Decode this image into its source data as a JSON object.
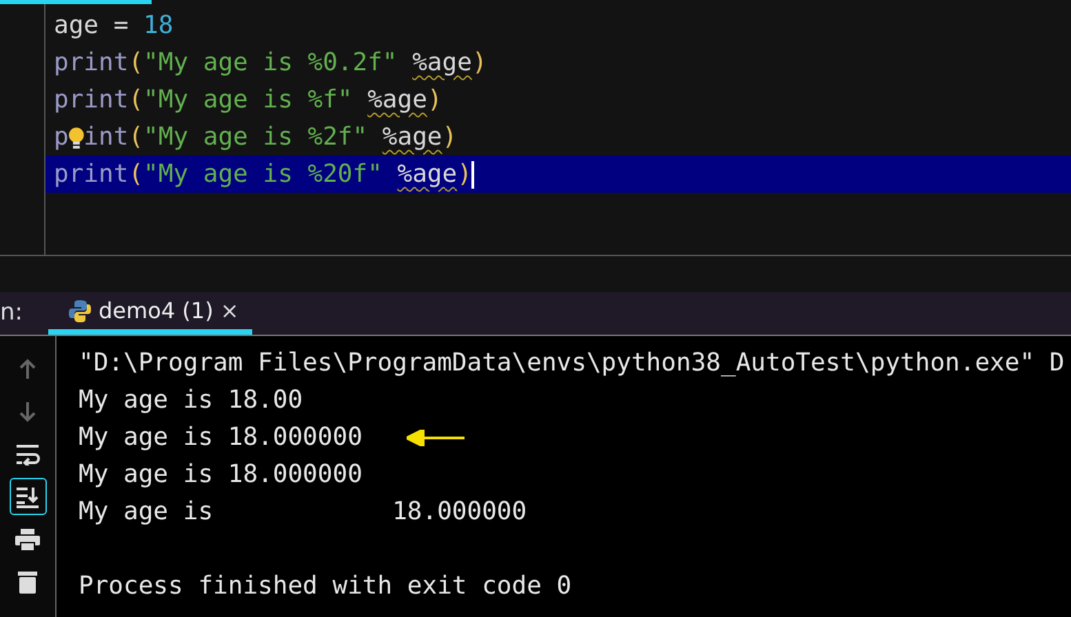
{
  "editor": {
    "lines": [
      {
        "selected": false,
        "tokens": [
          {
            "text": "age",
            "kind": "plain"
          },
          {
            "text": " = ",
            "kind": "plain"
          },
          {
            "text": "18",
            "kind": "number"
          }
        ]
      },
      {
        "selected": false,
        "tokens": [
          {
            "text": "print",
            "kind": "builtin"
          },
          {
            "text": "(",
            "kind": "paren"
          },
          {
            "text": "\"My age is %0.2f\"",
            "kind": "string"
          },
          {
            "kind": "space"
          },
          {
            "text": "%age",
            "kind": "warned"
          },
          {
            "text": ")",
            "kind": "paren"
          }
        ]
      },
      {
        "selected": false,
        "tokens": [
          {
            "text": "print",
            "kind": "builtin"
          },
          {
            "text": "(",
            "kind": "paren"
          },
          {
            "text": "\"My age is %f\"",
            "kind": "string"
          },
          {
            "kind": "space"
          },
          {
            "text": "%age",
            "kind": "warned"
          },
          {
            "text": ")",
            "kind": "paren"
          }
        ]
      },
      {
        "selected": false,
        "tokens": [
          {
            "text": "p",
            "kind": "builtin"
          },
          {
            "kind": "bulb"
          },
          {
            "text": "int",
            "kind": "builtin"
          },
          {
            "text": "(",
            "kind": "paren"
          },
          {
            "text": "\"My age is %2f\"",
            "kind": "string"
          },
          {
            "kind": "space"
          },
          {
            "text": "%age",
            "kind": "warned"
          },
          {
            "text": ")",
            "kind": "paren"
          }
        ]
      },
      {
        "selected": true,
        "tokens": [
          {
            "text": "print",
            "kind": "builtin"
          },
          {
            "text": "(",
            "kind": "paren"
          },
          {
            "text": "\"My age is %20f\"",
            "kind": "string"
          },
          {
            "kind": "space"
          },
          {
            "text": "%age",
            "kind": "warned"
          },
          {
            "text": ")",
            "kind": "paren"
          }
        ]
      }
    ]
  },
  "run_panel": {
    "label": "n:",
    "tabs": [
      {
        "label": "demo4 (1)",
        "close": "×",
        "selected": true
      }
    ],
    "toolbar": [
      {
        "kind": "up",
        "disabled": true,
        "selected": false
      },
      {
        "kind": "down",
        "disabled": true,
        "selected": false
      },
      {
        "kind": "wrap",
        "disabled": false,
        "selected": false
      },
      {
        "kind": "scroll",
        "disabled": false,
        "selected": true
      },
      {
        "kind": "print",
        "disabled": false,
        "selected": false
      },
      {
        "kind": "trash",
        "disabled": false,
        "selected": false
      }
    ],
    "output": [
      {
        "text": "\"D:\\Program Files\\ProgramData\\envs\\python38_AutoTest\\python.exe\" D"
      },
      {
        "text": "My age is 18.00"
      },
      {
        "text": "My age is 18.000000",
        "arrow": true
      },
      {
        "text": "My age is 18.000000"
      },
      {
        "text": "My age is            18.000000"
      },
      {
        "text": "Process finished with exit code 0",
        "gap_before": true
      }
    ]
  }
}
